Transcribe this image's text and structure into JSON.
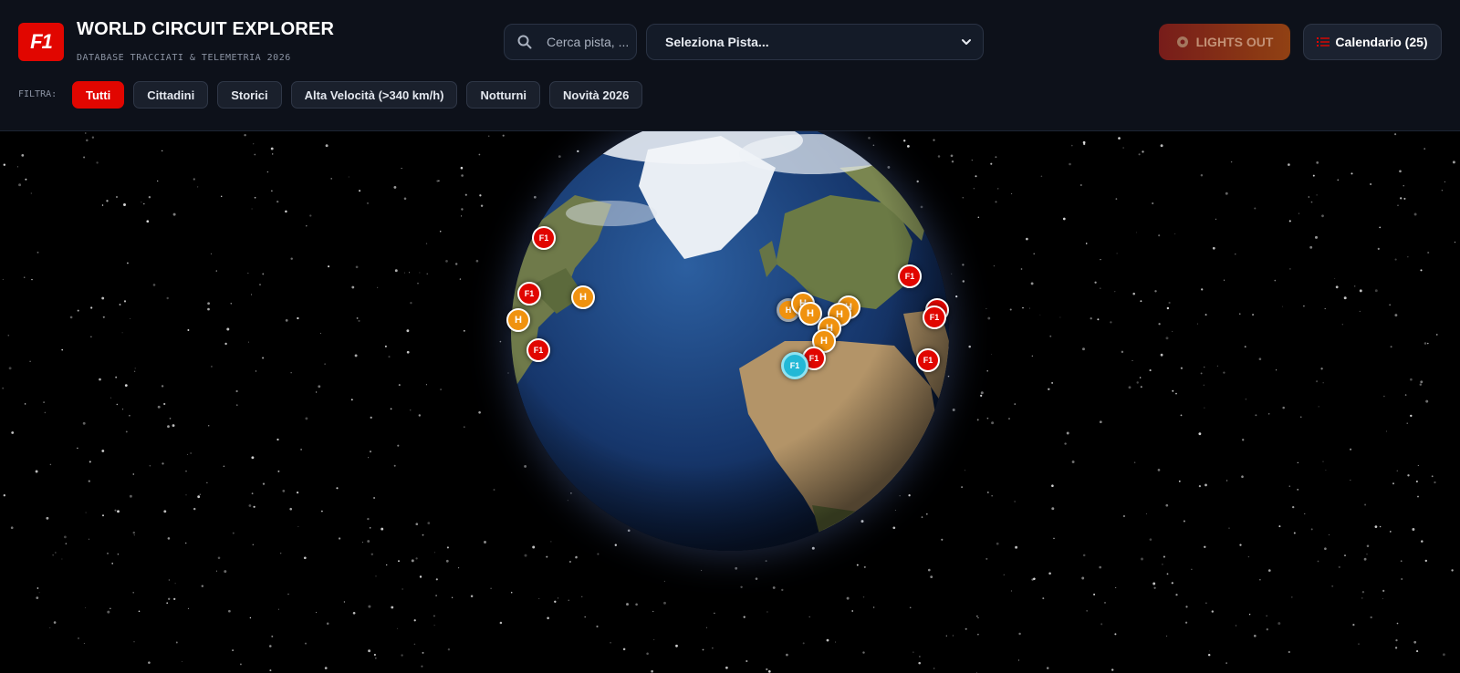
{
  "app": {
    "logo_text": "F1",
    "title": "WORLD CIRCUIT EXPLORER",
    "subtitle": "DATABASE TRACCIATI & TELEMETRIA 2026"
  },
  "search": {
    "placeholder": "Cerca pista, ..."
  },
  "track_select": {
    "selected": "Seleziona Pista..."
  },
  "buttons": {
    "lights_out": "LIGHTS OUT",
    "calendar": "Calendario (25)"
  },
  "filters": {
    "label": "FILTRA:",
    "chips": [
      {
        "label": "Tutti",
        "active": true
      },
      {
        "label": "Cittadini",
        "active": false
      },
      {
        "label": "Storici",
        "active": false
      },
      {
        "label": "Alta Velocità (>340 km/h)",
        "active": false
      },
      {
        "label": "Notturni",
        "active": false
      },
      {
        "label": "Novità 2026",
        "active": false
      }
    ]
  },
  "markers": {
    "f1_label": "F1",
    "historic_label": "H"
  },
  "colors": {
    "brand_red": "#e10600",
    "historic_orange": "#f0920f",
    "selected_cyan": "#22b8d6",
    "header_bg": "#0d111a"
  },
  "icons": [
    "f1-logo",
    "search-icon",
    "chevron-down-icon",
    "lights-icon",
    "list-icon"
  ]
}
